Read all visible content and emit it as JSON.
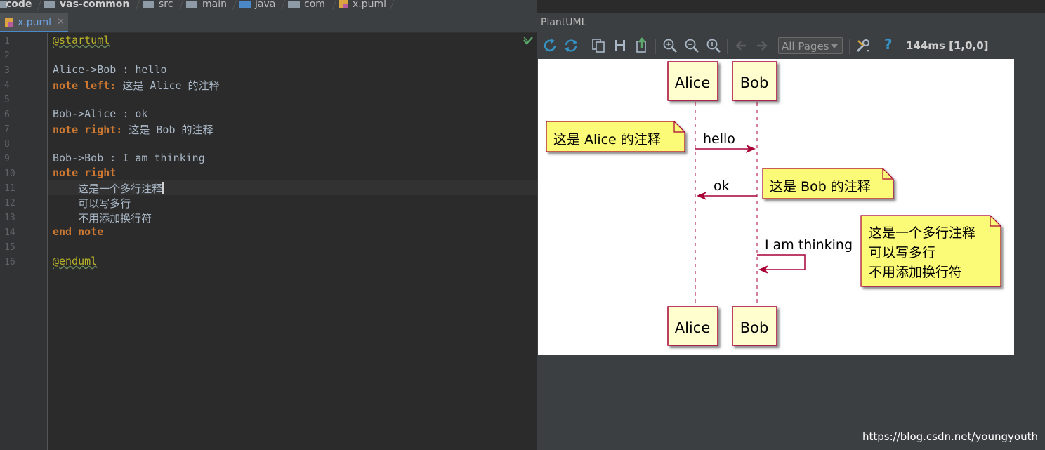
{
  "breadcrumb": [
    "code",
    "vas-common",
    "src",
    "main",
    "java",
    "com",
    "x.puml"
  ],
  "editor": {
    "tab_label": "x.puml",
    "line_numbers": [
      "1",
      "2",
      "3",
      "4",
      "5",
      "6",
      "7",
      "8",
      "9",
      "10",
      "11",
      "12",
      "13",
      "14",
      "15",
      "16"
    ],
    "lines": {
      "l1": {
        "at": "@",
        "kw": "startuml"
      },
      "l3": "Alice->Bob : hello",
      "l4": {
        "kw": "note left:",
        "text": " 这是 Alice 的注释"
      },
      "l6": "Bob->Alice : ok",
      "l7": {
        "kw": "note right:",
        "text": " 这是 Bob 的注释"
      },
      "l9": "Bob->Bob : I am thinking",
      "l10": {
        "kw": "note right"
      },
      "l11": "    这是一个多行注释",
      "l12": "    可以写多行",
      "l13": "    不用添加换行符",
      "l14": {
        "kw": "end note"
      },
      "l16": {
        "at": "@",
        "kw": "enduml"
      }
    }
  },
  "plantuml": {
    "panel_title": "PlantUML",
    "pages_select": "All Pages",
    "timing": "144ms [1,0,0]",
    "help_glyph": "?"
  },
  "diagram": {
    "participants": [
      "Alice",
      "Bob"
    ],
    "messages": [
      "hello",
      "ok",
      "I am thinking"
    ],
    "notes": {
      "alice": "这是 Alice 的注释",
      "bob": "这是 Bob 的注释",
      "multi": [
        "这是一个多行注释",
        "可以写多行",
        "不用添加换行符"
      ]
    }
  },
  "watermark": "https://blog.csdn.net/youngyouth",
  "colors": {
    "accent": "#4a88c7",
    "keyword": "#cc7832",
    "annotation": "#bbb529",
    "participant_fill": "#fefece",
    "participant_border": "#a80036",
    "note_fill": "#fbfb77"
  }
}
